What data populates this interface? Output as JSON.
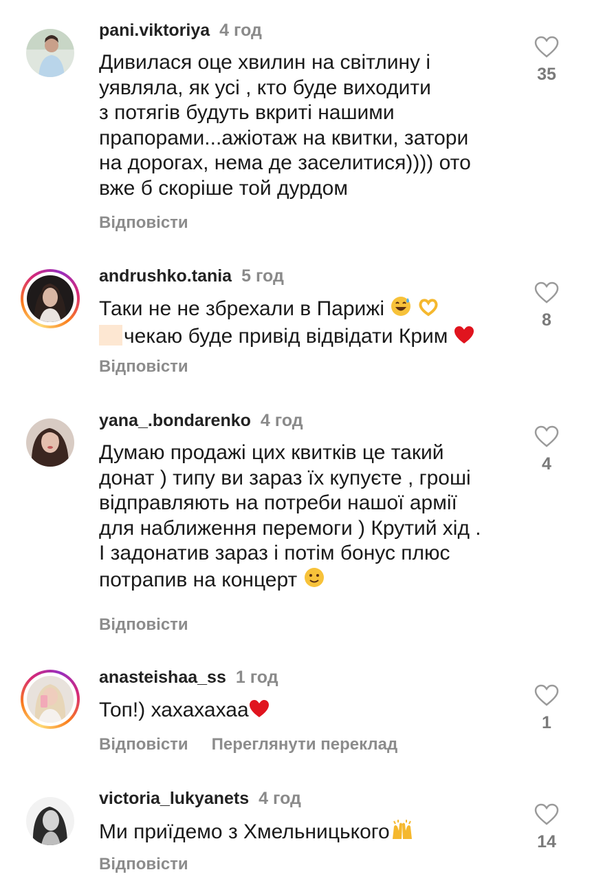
{
  "comments": [
    {
      "username": "pani.viktoriya",
      "time": "4 год",
      "lines": [
        "Дивилася оце хвилин на світлину і",
        "уявляла, як усі , кто буде виходити",
        "з потягів будуть вкриті нашими",
        "прапорами...ажіотаж на квитки, затори",
        "на дорогах, нема де заселитися)))) ото",
        "вже б скоріше той дурдом"
      ],
      "reply": "Відповісти",
      "likes": "35"
    },
    {
      "username": "andrushko.tania",
      "time": "5 год",
      "line1": "Таки не не збрехали в Парижі",
      "line2": "чекаю буде привід відвідати Крим",
      "emojis": [
        "grinning-sweat-emoji",
        "heart-hands-emoji",
        "red-heart-emoji"
      ],
      "reply": "Відповісти",
      "likes": "8"
    },
    {
      "username": "yana_.bondarenko",
      "time": "4 год",
      "lines": [
        "Думаю продажі цих квитків це такий",
        "донат ) типу ви зараз їх купуєте , гроші",
        "відправляють на потреби нашої армії",
        "для наближення перемоги ) Крутий хід .",
        "І задонатив зараз і потім бонус плюс"
      ],
      "last_line": "потрапив на концерт",
      "emojis": [
        "slightly-smiling-face-emoji"
      ],
      "reply": "Відповісти",
      "likes": "4"
    },
    {
      "username": "anasteishaa_ss",
      "time": "1 год",
      "text": "Топ!) хахахахаа",
      "emojis": [
        "red-heart-emoji"
      ],
      "reply": "Відповісти",
      "translate": "Переглянути переклад",
      "likes": "1"
    },
    {
      "username": "victoria_lukyanets",
      "time": "4 год",
      "text": "Ми приїдемо з Хмельницького",
      "emojis": [
        "raising-hands-emoji"
      ],
      "reply": "Відповісти",
      "likes": "14"
    }
  ],
  "colors": {
    "text": "#1a1a1a",
    "secondary": "#8a8a8a",
    "heart_red": "#e0141e",
    "story_ring": "#d62976"
  }
}
